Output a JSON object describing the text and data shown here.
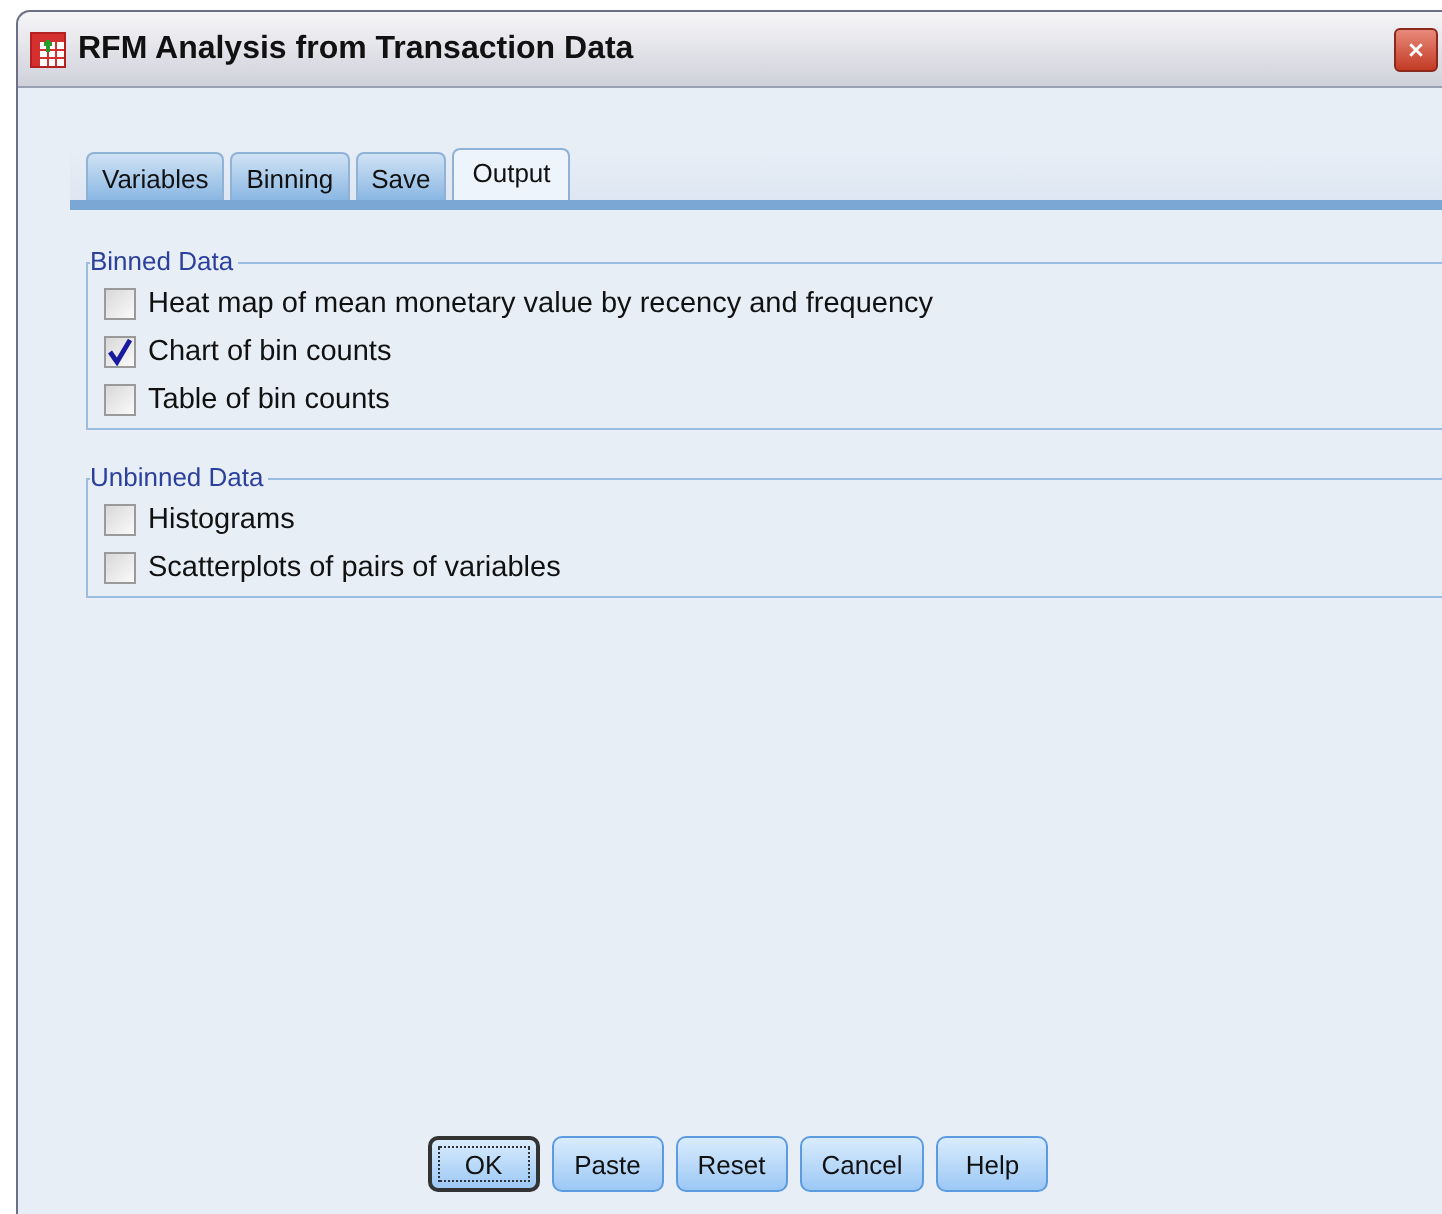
{
  "window": {
    "title": "RFM Analysis from Transaction Data"
  },
  "tabs": [
    {
      "label": "Variables",
      "selected": false
    },
    {
      "label": "Binning",
      "selected": false
    },
    {
      "label": "Save",
      "selected": false
    },
    {
      "label": "Output",
      "selected": true
    }
  ],
  "groups": [
    {
      "title": "Binned Data",
      "options": [
        {
          "label": "Heat map of mean monetary value by recency and frequency",
          "checked": false
        },
        {
          "label": "Chart of bin counts",
          "checked": true
        },
        {
          "label": "Table of bin counts",
          "checked": false
        }
      ]
    },
    {
      "title": "Unbinned Data",
      "options": [
        {
          "label": "Histograms",
          "checked": false
        },
        {
          "label": "Scatterplots of pairs of variables",
          "checked": false
        }
      ]
    }
  ],
  "buttons": [
    {
      "label": "OK",
      "default": true
    },
    {
      "label": "Paste",
      "default": false
    },
    {
      "label": "Reset",
      "default": false
    },
    {
      "label": "Cancel",
      "default": false
    },
    {
      "label": "Help",
      "default": false
    }
  ]
}
